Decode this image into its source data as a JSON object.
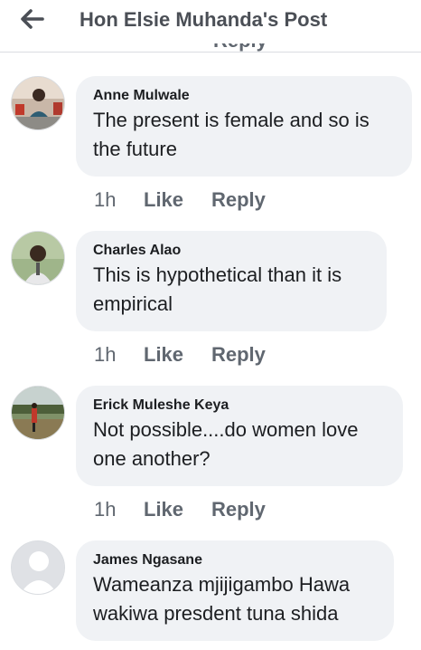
{
  "header": {
    "title": "Hon Elsie Muhanda's Post",
    "back_icon": "arrow-left-icon"
  },
  "partial_text": "Reply",
  "comments": [
    {
      "author": "Anne Mulwale",
      "text": "The present is female and so is the future",
      "time": "1h",
      "like": "Like",
      "reply": "Reply"
    },
    {
      "author": "Charles Alao",
      "text": "This is hypothetical than it is empirical",
      "time": "1h",
      "like": "Like",
      "reply": "Reply"
    },
    {
      "author": "Erick Muleshe Keya",
      "text": "Not possible....do women love one another?",
      "time": "1h",
      "like": "Like",
      "reply": "Reply"
    },
    {
      "author": "James Ngasane",
      "text": "Wameanza mjijigambo Hawa wakiwa presdent tuna shida",
      "time": "",
      "like": "",
      "reply": ""
    }
  ],
  "colors": {
    "bubble": "#f0f2f5",
    "meta": "#606770",
    "title": "#4b4f56"
  }
}
